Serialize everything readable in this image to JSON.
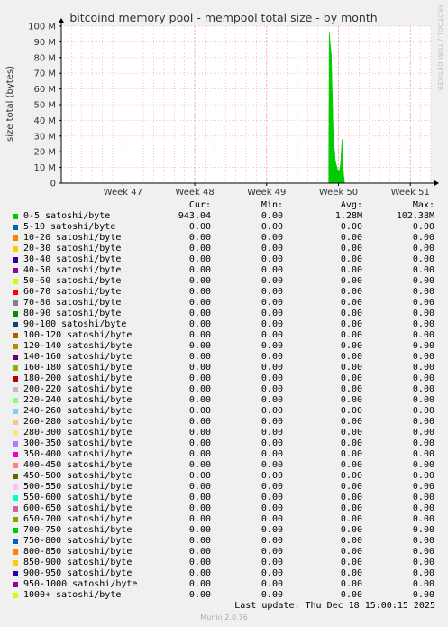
{
  "title": "bitcoind memory pool - mempool total size - by month",
  "side_label": "RRDTOOL / TOBI OETIKER",
  "legend_headers": {
    "cur": "Cur:",
    "min": "Min:",
    "avg": "Avg:",
    "max": "Max:"
  },
  "legend": [
    {
      "label": "0-5 satoshi/byte",
      "color": "#00cc00",
      "cur": "943.04",
      "min": "0.00",
      "avg": "1.28M",
      "max": "102.38M"
    },
    {
      "label": "5-10 satoshi/byte",
      "color": "#0066b3",
      "cur": "0.00",
      "min": "0.00",
      "avg": "0.00",
      "max": "0.00"
    },
    {
      "label": "10-20 satoshi/byte",
      "color": "#ff8000",
      "cur": "0.00",
      "min": "0.00",
      "avg": "0.00",
      "max": "0.00"
    },
    {
      "label": "20-30 satoshi/byte",
      "color": "#ffcc00",
      "cur": "0.00",
      "min": "0.00",
      "avg": "0.00",
      "max": "0.00"
    },
    {
      "label": "30-40 satoshi/byte",
      "color": "#330099",
      "cur": "0.00",
      "min": "0.00",
      "avg": "0.00",
      "max": "0.00"
    },
    {
      "label": "40-50 satoshi/byte",
      "color": "#990099",
      "cur": "0.00",
      "min": "0.00",
      "avg": "0.00",
      "max": "0.00"
    },
    {
      "label": "50-60 satoshi/byte",
      "color": "#ccff00",
      "cur": "0.00",
      "min": "0.00",
      "avg": "0.00",
      "max": "0.00"
    },
    {
      "label": "60-70 satoshi/byte",
      "color": "#ff0000",
      "cur": "0.00",
      "min": "0.00",
      "avg": "0.00",
      "max": "0.00"
    },
    {
      "label": "70-80 satoshi/byte",
      "color": "#808080",
      "cur": "0.00",
      "min": "0.00",
      "avg": "0.00",
      "max": "0.00"
    },
    {
      "label": "80-90 satoshi/byte",
      "color": "#008f00",
      "cur": "0.00",
      "min": "0.00",
      "avg": "0.00",
      "max": "0.00"
    },
    {
      "label": "90-100 satoshi/byte",
      "color": "#00487d",
      "cur": "0.00",
      "min": "0.00",
      "avg": "0.00",
      "max": "0.00"
    },
    {
      "label": "100-120 satoshi/byte",
      "color": "#b35a00",
      "cur": "0.00",
      "min": "0.00",
      "avg": "0.00",
      "max": "0.00"
    },
    {
      "label": "120-140 satoshi/byte",
      "color": "#b38f00",
      "cur": "0.00",
      "min": "0.00",
      "avg": "0.00",
      "max": "0.00"
    },
    {
      "label": "140-160 satoshi/byte",
      "color": "#6b006b",
      "cur": "0.00",
      "min": "0.00",
      "avg": "0.00",
      "max": "0.00"
    },
    {
      "label": "160-180 satoshi/byte",
      "color": "#8fb300",
      "cur": "0.00",
      "min": "0.00",
      "avg": "0.00",
      "max": "0.00"
    },
    {
      "label": "180-200 satoshi/byte",
      "color": "#b30000",
      "cur": "0.00",
      "min": "0.00",
      "avg": "0.00",
      "max": "0.00"
    },
    {
      "label": "200-220 satoshi/byte",
      "color": "#bebebe",
      "cur": "0.00",
      "min": "0.00",
      "avg": "0.00",
      "max": "0.00"
    },
    {
      "label": "220-240 satoshi/byte",
      "color": "#80ff80",
      "cur": "0.00",
      "min": "0.00",
      "avg": "0.00",
      "max": "0.00"
    },
    {
      "label": "240-260 satoshi/byte",
      "color": "#80c9ff",
      "cur": "0.00",
      "min": "0.00",
      "avg": "0.00",
      "max": "0.00"
    },
    {
      "label": "260-280 satoshi/byte",
      "color": "#ffc080",
      "cur": "0.00",
      "min": "0.00",
      "avg": "0.00",
      "max": "0.00"
    },
    {
      "label": "280-300 satoshi/byte",
      "color": "#ffe680",
      "cur": "0.00",
      "min": "0.00",
      "avg": "0.00",
      "max": "0.00"
    },
    {
      "label": "300-350 satoshi/byte",
      "color": "#aa80ff",
      "cur": "0.00",
      "min": "0.00",
      "avg": "0.00",
      "max": "0.00"
    },
    {
      "label": "350-400 satoshi/byte",
      "color": "#ee00cc",
      "cur": "0.00",
      "min": "0.00",
      "avg": "0.00",
      "max": "0.00"
    },
    {
      "label": "400-450 satoshi/byte",
      "color": "#ff8080",
      "cur": "0.00",
      "min": "0.00",
      "avg": "0.00",
      "max": "0.00"
    },
    {
      "label": "450-500 satoshi/byte",
      "color": "#666600",
      "cur": "0.00",
      "min": "0.00",
      "avg": "0.00",
      "max": "0.00"
    },
    {
      "label": "500-550 satoshi/byte",
      "color": "#ffbfff",
      "cur": "0.00",
      "min": "0.00",
      "avg": "0.00",
      "max": "0.00"
    },
    {
      "label": "550-600 satoshi/byte",
      "color": "#00ffcc",
      "cur": "0.00",
      "min": "0.00",
      "avg": "0.00",
      "max": "0.00"
    },
    {
      "label": "600-650 satoshi/byte",
      "color": "#cc6699",
      "cur": "0.00",
      "min": "0.00",
      "avg": "0.00",
      "max": "0.00"
    },
    {
      "label": "650-700 satoshi/byte",
      "color": "#999900",
      "cur": "0.00",
      "min": "0.00",
      "avg": "0.00",
      "max": "0.00"
    },
    {
      "label": "700-750 satoshi/byte",
      "color": "#00cc00",
      "cur": "0.00",
      "min": "0.00",
      "avg": "0.00",
      "max": "0.00"
    },
    {
      "label": "750-800 satoshi/byte",
      "color": "#0066b3",
      "cur": "0.00",
      "min": "0.00",
      "avg": "0.00",
      "max": "0.00"
    },
    {
      "label": "800-850 satoshi/byte",
      "color": "#ff8000",
      "cur": "0.00",
      "min": "0.00",
      "avg": "0.00",
      "max": "0.00"
    },
    {
      "label": "850-900 satoshi/byte",
      "color": "#ffcc00",
      "cur": "0.00",
      "min": "0.00",
      "avg": "0.00",
      "max": "0.00"
    },
    {
      "label": "900-950 satoshi/byte",
      "color": "#330099",
      "cur": "0.00",
      "min": "0.00",
      "avg": "0.00",
      "max": "0.00"
    },
    {
      "label": "950-1000 satoshi/byte",
      "color": "#990099",
      "cur": "0.00",
      "min": "0.00",
      "avg": "0.00",
      "max": "0.00"
    },
    {
      "label": "1000+ satoshi/byte",
      "color": "#ccff00",
      "cur": "0.00",
      "min": "0.00",
      "avg": "0.00",
      "max": "0.00"
    }
  ],
  "last_update": "Last update: Thu Dec 18 15:00:15 2025",
  "munin_version": "Munin 2.0.76",
  "chart_data": {
    "type": "area",
    "title": "bitcoind memory pool - mempool total size - by month",
    "ylabel": "size total (bytes)",
    "xlabel": "",
    "ylim": [
      0,
      100000000
    ],
    "yticks": [
      0,
      10000000,
      20000000,
      30000000,
      40000000,
      50000000,
      60000000,
      70000000,
      80000000,
      90000000,
      100000000
    ],
    "ytick_labels": [
      "0",
      "10 M",
      "20 M",
      "30 M",
      "40 M",
      "50 M",
      "60 M",
      "70 M",
      "80 M",
      "90 M",
      "100 M"
    ],
    "xlim": [
      0,
      36
    ],
    "xticks": [
      {
        "label": "Week 47",
        "x": 6
      },
      {
        "label": "Week 48",
        "x": 13
      },
      {
        "label": "Week 49",
        "x": 20
      },
      {
        "label": "Week 50",
        "x": 27
      },
      {
        "label": "Week 51",
        "x": 34
      }
    ],
    "grid": true,
    "background_color": "#ffffff",
    "grid_color": "#ff9999",
    "series": [
      {
        "name": "0-5 satoshi/byte",
        "color": "#00cc00",
        "points": [
          [
            26.05,
            0
          ],
          [
            26.1,
            96000000
          ],
          [
            26.3,
            82000000
          ],
          [
            26.5,
            30000000
          ],
          [
            26.7,
            14000000
          ],
          [
            26.9,
            9000000
          ],
          [
            27.0,
            8000000
          ],
          [
            27.1,
            8500000
          ],
          [
            27.2,
            12000000
          ],
          [
            27.35,
            28000000
          ],
          [
            27.4,
            14000000
          ],
          [
            27.5,
            6000000
          ],
          [
            27.6,
            0
          ]
        ]
      }
    ]
  }
}
